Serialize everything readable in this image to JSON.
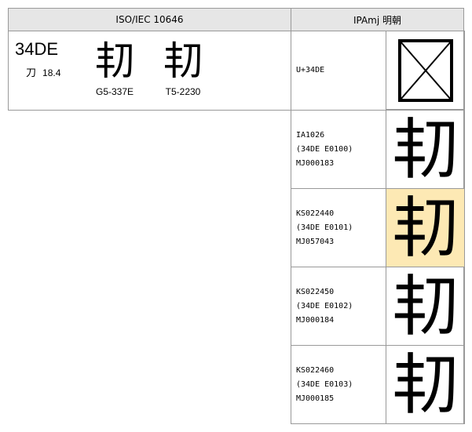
{
  "header": {
    "iso_title": "ISO/IEC 10646",
    "ipa_title": "IPAmj 明朝"
  },
  "iso": {
    "codepoint": "34DE",
    "radical_char": "刀",
    "radical_stroke": "18.4",
    "glyph": "㓞",
    "refs": [
      {
        "glyph": "㓞",
        "label": "G5-337E"
      },
      {
        "glyph": "㓞",
        "label": "T5-2230"
      }
    ]
  },
  "ipamj": {
    "rows": [
      {
        "code_lines": [
          "U+34DE"
        ],
        "glyph": "",
        "missing_glyph_icon": "box-with-x-icon",
        "highlight": false
      },
      {
        "code_lines": [
          "IA1026",
          "(34DE E0100)",
          "MJ000183"
        ],
        "glyph": "㓞",
        "highlight": false
      },
      {
        "code_lines": [
          "KS022440",
          "(34DE E0101)",
          "MJ057043"
        ],
        "glyph": "㓞",
        "highlight": true,
        "highlight_color": "#fde9b4"
      },
      {
        "code_lines": [
          "KS022450",
          "(34DE E0102)",
          "MJ000184"
        ],
        "glyph": "㓞",
        "highlight": false
      },
      {
        "code_lines": [
          "KS022460",
          "(34DE E0103)",
          "MJ000185"
        ],
        "glyph": "㓞",
        "highlight": false
      }
    ]
  }
}
